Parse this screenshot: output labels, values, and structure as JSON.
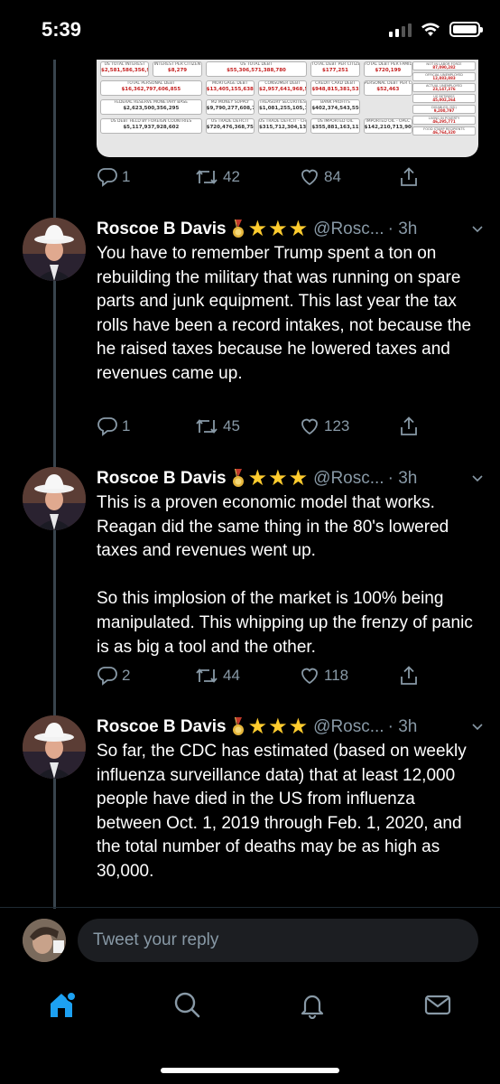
{
  "status_bar": {
    "time": "5:39"
  },
  "debt_clock": {
    "cells": [
      {
        "label": "US TOTAL INTEREST",
        "value": "$2,581,586,356,977"
      },
      {
        "label": "INTEREST PER CITIZEN",
        "value": "$8,279"
      },
      {
        "label": "US TOTAL DEBT",
        "value": "$55,306,571,388,780",
        "wide": true
      },
      {
        "label": "TOTAL DEBT PER CITIZEN",
        "value": "$177,251"
      },
      {
        "label": "TOTAL DEBT PER FAMILY",
        "value": "$720,199"
      },
      {
        "label": "TOTAL PERSONAL DEBT",
        "value": "$16,362,797,606,855",
        "wide": true
      },
      {
        "label": "MORTGAGE DEBT",
        "value": "$13,405,155,638,270"
      },
      {
        "label": "CONSUMER DEBT",
        "value": "$2,957,641,968,585"
      },
      {
        "label": "CREDIT CARD DEBT",
        "value": "$948,815,381,535"
      },
      {
        "label": "PERSONAL DEBT PER CIT",
        "value": "$52,463"
      },
      {
        "label": "FEDERAL RESERVE MONETARY BASE",
        "value": "$2,623,500,356,295",
        "wide": true,
        "dark": true
      },
      {
        "label": "M2 MONEY SUPPLY",
        "value": "$9,790,277,608,749",
        "dark": true
      },
      {
        "label": "TREASURY SECURITIES",
        "value": "$1,081,255,105,187",
        "dark": true
      },
      {
        "label": "BANK PROFITS",
        "value": "$402,374,543,550",
        "dark": true
      },
      {
        "label": "US DEBT HELD BY FOREIGN COUNTRIES",
        "value": "$5,117,937,928,602",
        "wide": true,
        "dark": true
      },
      {
        "label": "US TRADE DEFICIT",
        "value": "$720,476,368,750",
        "dark": true
      },
      {
        "label": "US TRADE DEFICIT - CHINA",
        "value": "$315,712,304,130",
        "dark": true
      },
      {
        "label": "US IMPORTED OIL",
        "value": "$355,881,163,117",
        "dark": true
      },
      {
        "label": "IMPORTED OIL - OPEC",
        "value": "$142,210,713,907",
        "dark": true
      }
    ],
    "side": [
      {
        "label": "NOT IN LABOR FORCE",
        "value": "87,090,282"
      },
      {
        "label": "OFFICIAL UNEMPLOYED",
        "value": "12,883,883"
      },
      {
        "label": "ACTUAL UNEMPLOYED",
        "value": "23,147,376"
      },
      {
        "label": "US RETIREES",
        "value": "45,002,264"
      },
      {
        "label": "DISABLED (SSI)",
        "value": "9,200,797"
      },
      {
        "label": "LIVING IN POVERTY",
        "value": "46,295,771"
      },
      {
        "label": "FOOD STAMP RECIPIENTS",
        "value": "46,764,320"
      }
    ]
  },
  "first_actions": {
    "replies": "1",
    "retweets": "42",
    "likes": "84"
  },
  "tweets": [
    {
      "name": "Roscoe B Davis",
      "handle": "@Rosc...",
      "time": "· 3h",
      "body": "You have to remember Trump spent a ton on rebuilding the military that was running on spare parts and junk equipment. This last year the tax rolls have been a record intakes, not because the he raised taxes because he lowered taxes and revenues came up.",
      "replies": "1",
      "retweets": "45",
      "likes": "123"
    },
    {
      "name": "Roscoe B Davis",
      "handle": "@Rosc...",
      "time": "· 3h",
      "body": "This is a proven economic model that works. Reagan did the same thing in the 80's lowered taxes and revenues went up.\n\nSo this implosion of the market is 100% being manipulated. This whipping up the frenzy of panic is as big a tool and the other.",
      "replies": "2",
      "retweets": "44",
      "likes": "118"
    },
    {
      "name": "Roscoe B Davis",
      "handle": "@Rosc...",
      "time": "· 3h",
      "body": "So far, the CDC has estimated (based on weekly influenza surveillance data) that at least 12,000 people have died in the US from influenza between Oct. 1, 2019 through Feb. 1, 2020, and the total number of deaths may be as high as 30,000."
    }
  ],
  "composer": {
    "placeholder": "Tweet your reply"
  },
  "colors": {
    "accent": "#1da1f2",
    "muted": "#8899a6",
    "star": "#ffcc2e",
    "thread": "#38444d"
  }
}
